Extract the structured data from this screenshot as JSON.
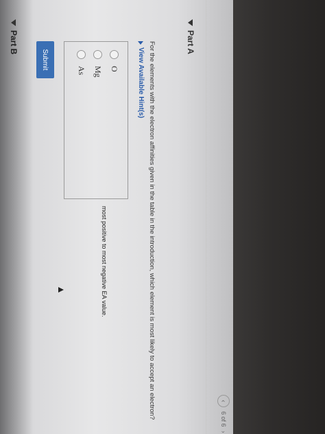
{
  "pager": {
    "prev_symbol": "‹",
    "label": "6 of 6",
    "next_symbol": "›"
  },
  "part_a": {
    "title": "Part A",
    "question": "For the elements with the electron affinities given in the table in the introduction, which element is most likely to accept an electron?",
    "hint_label": "View Available Hint(s)",
    "options": [
      "O",
      "Mg",
      "As"
    ],
    "submit_label": "Submit"
  },
  "footnote": "most positive to most negative EA value.",
  "part_b": {
    "title": "Part B"
  }
}
